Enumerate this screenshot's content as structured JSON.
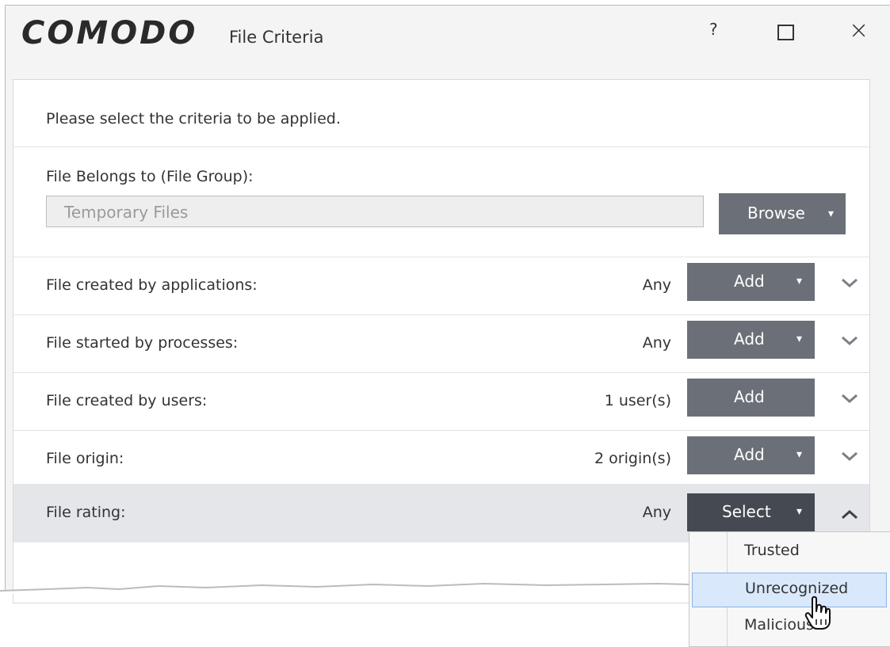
{
  "window": {
    "brand": "COMODO",
    "title": "File Criteria",
    "help_glyph": "?",
    "close_glyph": "×"
  },
  "instruction": "Please select the criteria to be applied.",
  "file_group": {
    "label": "File Belongs to (File Group):",
    "value": "Temporary Files",
    "browse_label": "Browse"
  },
  "criteria": [
    {
      "label": "File created by applications:",
      "count": "Any",
      "button": "Add",
      "has_caret": true
    },
    {
      "label": "File started by processes:",
      "count": "Any",
      "button": "Add",
      "has_caret": true
    },
    {
      "label": "File created by users:",
      "count": "1 user(s)",
      "button": "Add",
      "has_caret": false
    },
    {
      "label": "File origin:",
      "count": "2 origin(s)",
      "button": "Add",
      "has_caret": true
    },
    {
      "label": "File rating:",
      "count": "Any",
      "button": "Select",
      "has_caret": true,
      "expanded": true
    }
  ],
  "rating_menu": {
    "options": [
      "Trusted",
      "Unrecognized",
      "Malicious"
    ],
    "hovered": "Unrecognized"
  },
  "colors": {
    "button": "#6b7078",
    "button_active": "#454a52",
    "row_highlight": "#e4e6ea",
    "menu_hover": "#d9e8fa"
  },
  "icons": {
    "caret": "▾",
    "chevron_down": "chevron-down-icon",
    "chevron_up": "chevron-up-icon",
    "cursor": "hand-pointer-icon"
  }
}
